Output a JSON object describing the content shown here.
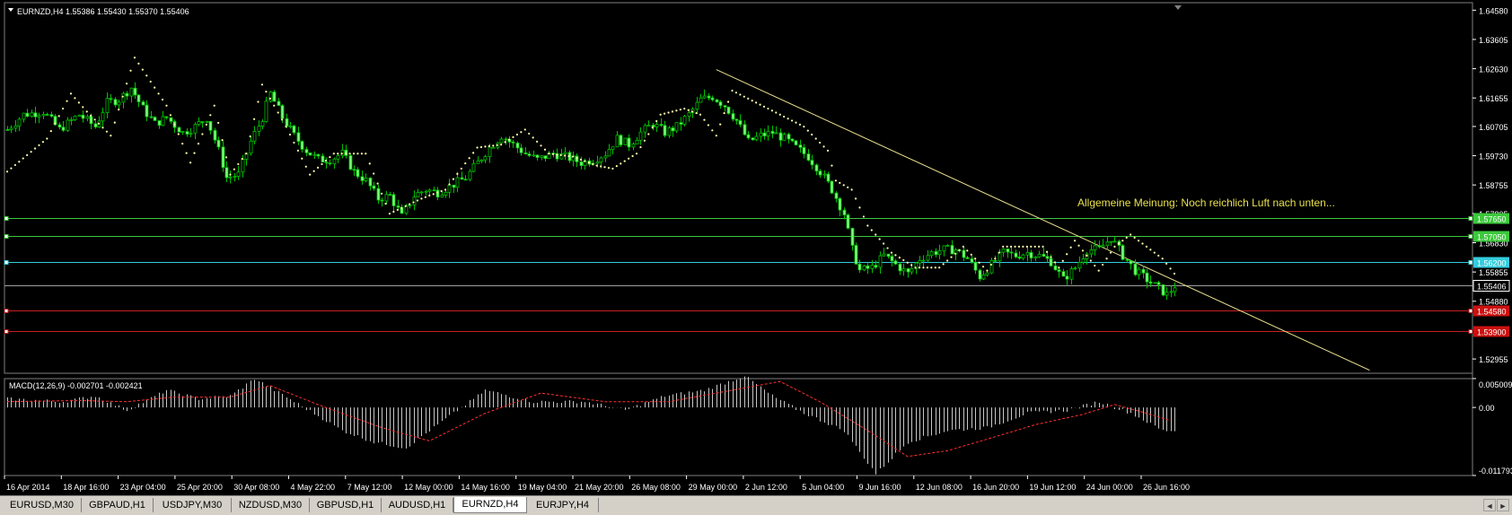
{
  "window": {
    "menu_icon": "triangle-down-icon",
    "header_text": "EURNZD,H4  1.55386 1.55430 1.55370 1.55406",
    "annotation": "Allgemeine Meinung: Noch reichlich Luft nach unten..."
  },
  "colors": {
    "background": "#000000",
    "candle": "#00c000",
    "candle_bright": "#7fff7f",
    "psar": "#ffffaa",
    "trendline": "#e8e08c",
    "annotation": "#e8e04c",
    "grid_text": "#ffffff",
    "level_green": "#3cc83c",
    "level_cyan": "#33ccdd",
    "level_red": "#c82020",
    "level_gray": "#a0a0a0",
    "macd_hist": "#c8c8c8",
    "macd_signal": "#ff3030"
  },
  "price_axis": {
    "ticks": [
      "1.64580",
      "1.63605",
      "1.62630",
      "1.61655",
      "1.60705",
      "1.59730",
      "1.58755",
      "1.57805",
      "1.56830",
      "1.55855",
      "1.54880",
      "1.52955"
    ]
  },
  "levels": [
    {
      "label": "1.57650",
      "value": 1.5765,
      "style": "green"
    },
    {
      "label": "1.57050",
      "value": 1.5705,
      "style": "green"
    },
    {
      "label": "1.56200",
      "value": 1.562,
      "style": "cyan"
    },
    {
      "label": "1.55406",
      "value": 1.55406,
      "style": "current"
    },
    {
      "label": "1.54580",
      "value": 1.5458,
      "style": "red"
    },
    {
      "label": "1.53900",
      "value": 1.539,
      "style": "red"
    }
  ],
  "macd": {
    "header": "MACD(12,26,9) -0.002701 -0.002421",
    "ticks": [
      "0.005009",
      "0.00",
      "-0.011793"
    ]
  },
  "time_axis": {
    "ticks": [
      "16 Apr 2014",
      "18 Apr 16:00",
      "23 Apr 04:00",
      "25 Apr 20:00",
      "30 Apr 08:00",
      "4 May 22:00",
      "7 May 12:00",
      "12 May 00:00",
      "14 May 16:00",
      "19 May 04:00",
      "21 May 20:00",
      "26 May 08:00",
      "29 May 00:00",
      "2 Jun 12:00",
      "5 Jun 04:00",
      "9 Jun 16:00",
      "12 Jun 08:00",
      "16 Jun 20:00",
      "19 Jun 12:00",
      "24 Jun 00:00",
      "26 Jun 16:00"
    ]
  },
  "tabs": [
    {
      "label": "EURUSD,M30",
      "active": false
    },
    {
      "label": "GBPAUD,H1",
      "active": false
    },
    {
      "label": "USDJPY,M30",
      "active": false
    },
    {
      "label": "NZDUSD,M30",
      "active": false
    },
    {
      "label": "GBPUSD,H1",
      "active": false
    },
    {
      "label": "AUDUSD,H1",
      "active": false
    },
    {
      "label": "EURNZD,H4",
      "active": true
    },
    {
      "label": "EURJPY,H4",
      "active": false
    }
  ],
  "tab_nav": {
    "left": "◄",
    "right": "►"
  },
  "chart_data": {
    "type": "candlestick",
    "symbol": "EURNZD",
    "timeframe": "H4",
    "ohlc_current": {
      "open": 1.55386,
      "high": 1.5543,
      "low": 1.5537,
      "close": 1.55406
    },
    "ylim": [
      1.5248,
      1.6483
    ],
    "close_path": [
      [
        0,
        1.606
      ],
      [
        4,
        1.611
      ],
      [
        9,
        1.612
      ],
      [
        13,
        1.606
      ],
      [
        18,
        1.611
      ],
      [
        22,
        1.607
      ],
      [
        25,
        1.615
      ],
      [
        28,
        1.616
      ],
      [
        31,
        1.62
      ],
      [
        34,
        1.613
      ],
      [
        37,
        1.608
      ],
      [
        40,
        1.61
      ],
      [
        44,
        1.605
      ],
      [
        47,
        1.607
      ],
      [
        50,
        1.61
      ],
      [
        53,
        1.599
      ],
      [
        55,
        1.59
      ],
      [
        58,
        1.591
      ],
      [
        61,
        1.602
      ],
      [
        64,
        1.61
      ],
      [
        66,
        1.618
      ],
      [
        69,
        1.61
      ],
      [
        72,
        1.604
      ],
      [
        75,
        1.599
      ],
      [
        78,
        1.596
      ],
      [
        81,
        1.596
      ],
      [
        84,
        1.598
      ],
      [
        87,
        1.592
      ],
      [
        90,
        1.589
      ],
      [
        93,
        1.583
      ],
      [
        96,
        1.584
      ],
      [
        99,
        1.577
      ],
      [
        102,
        1.584
      ],
      [
        105,
        1.586
      ],
      [
        108,
        1.585
      ],
      [
        111,
        1.587
      ],
      [
        115,
        1.59
      ],
      [
        118,
        1.595
      ],
      [
        121,
        1.6
      ],
      [
        124,
        1.604
      ],
      [
        127,
        1.601
      ],
      [
        130,
        1.598
      ],
      [
        133,
        1.596
      ],
      [
        137,
        1.598
      ],
      [
        140,
        1.597
      ],
      [
        144,
        1.595
      ],
      [
        147,
        1.596
      ],
      [
        150,
        1.598
      ],
      [
        153,
        1.603
      ],
      [
        156,
        1.601
      ],
      [
        159,
        1.605
      ],
      [
        162,
        1.608
      ],
      [
        165,
        1.605
      ],
      [
        168,
        1.607
      ],
      [
        171,
        1.611
      ],
      [
        174,
        1.616
      ],
      [
        177,
        1.617
      ],
      [
        180,
        1.614
      ],
      [
        183,
        1.609
      ],
      [
        186,
        1.602
      ],
      [
        189,
        1.604
      ],
      [
        192,
        1.605
      ],
      [
        195,
        1.603
      ],
      [
        198,
        1.6
      ],
      [
        201,
        1.597
      ],
      [
        204,
        1.592
      ],
      [
        207,
        1.586
      ],
      [
        210,
        1.578
      ],
      [
        212,
        1.566
      ],
      [
        214,
        1.559
      ],
      [
        217,
        1.56
      ],
      [
        220,
        1.564
      ],
      [
        223,
        1.561
      ],
      [
        226,
        1.558
      ],
      [
        229,
        1.563
      ],
      [
        232,
        1.565
      ],
      [
        235,
        1.566
      ],
      [
        238,
        1.566
      ],
      [
        241,
        1.563
      ],
      [
        244,
        1.557
      ],
      [
        247,
        1.561
      ],
      [
        250,
        1.565
      ],
      [
        253,
        1.564
      ],
      [
        256,
        1.565
      ],
      [
        259,
        1.564
      ],
      [
        262,
        1.562
      ],
      [
        265,
        1.556
      ],
      [
        268,
        1.56
      ],
      [
        271,
        1.566
      ],
      [
        274,
        1.566
      ],
      [
        277,
        1.57
      ],
      [
        280,
        1.564
      ],
      [
        283,
        1.559
      ],
      [
        286,
        1.556
      ],
      [
        289,
        1.553
      ],
      [
        291,
        1.551
      ],
      [
        293,
        1.554
      ]
    ],
    "psar_path": [
      [
        0,
        1.592
      ],
      [
        10,
        1.603
      ],
      [
        16,
        1.618
      ],
      [
        20,
        1.612
      ],
      [
        26,
        1.604
      ],
      [
        32,
        1.63
      ],
      [
        40,
        1.614
      ],
      [
        46,
        1.595
      ],
      [
        52,
        1.614
      ],
      [
        56,
        1.591
      ],
      [
        60,
        1.598
      ],
      [
        64,
        1.621
      ],
      [
        70,
        1.607
      ],
      [
        76,
        1.591
      ],
      [
        82,
        1.598
      ],
      [
        90,
        1.598
      ],
      [
        96,
        1.578
      ],
      [
        104,
        1.583
      ],
      [
        110,
        1.586
      ],
      [
        118,
        1.6
      ],
      [
        124,
        1.601
      ],
      [
        130,
        1.606
      ],
      [
        136,
        1.598
      ],
      [
        142,
        1.597
      ],
      [
        148,
        1.594
      ],
      [
        152,
        1.593
      ],
      [
        158,
        1.598
      ],
      [
        164,
        1.611
      ],
      [
        170,
        1.613
      ],
      [
        174,
        1.611
      ],
      [
        178,
        1.604
      ],
      [
        182,
        1.619
      ],
      [
        188,
        1.615
      ],
      [
        194,
        1.611
      ],
      [
        200,
        1.607
      ],
      [
        206,
        1.599
      ],
      [
        208,
        1.589
      ],
      [
        212,
        1.586
      ],
      [
        216,
        1.574
      ],
      [
        222,
        1.565
      ],
      [
        228,
        1.56
      ],
      [
        234,
        1.56
      ],
      [
        240,
        1.567
      ],
      [
        246,
        1.559
      ],
      [
        250,
        1.567
      ],
      [
        256,
        1.567
      ],
      [
        260,
        1.567
      ],
      [
        264,
        1.56
      ],
      [
        268,
        1.569
      ],
      [
        274,
        1.559
      ],
      [
        278,
        1.567
      ],
      [
        282,
        1.571
      ],
      [
        286,
        1.567
      ],
      [
        290,
        1.563
      ],
      [
        293,
        1.558
      ]
    ],
    "trendline": {
      "from": [
        178,
        1.626
      ],
      "to": [
        342,
        1.5258
      ]
    },
    "macd_hist_path": [
      [
        0,
        0.0015
      ],
      [
        14,
        0.001
      ],
      [
        22,
        0.002
      ],
      [
        30,
        -0.0005
      ],
      [
        40,
        0.003
      ],
      [
        48,
        0.0015
      ],
      [
        56,
        0.002
      ],
      [
        62,
        0.005
      ],
      [
        72,
        0.001
      ],
      [
        84,
        -0.004
      ],
      [
        92,
        -0.006
      ],
      [
        100,
        -0.007
      ],
      [
        110,
        -0.002
      ],
      [
        120,
        0.003
      ],
      [
        132,
        0.001
      ],
      [
        145,
        0.001
      ],
      [
        155,
        -0.0005
      ],
      [
        165,
        0.002
      ],
      [
        175,
        0.003
      ],
      [
        185,
        0.0055
      ],
      [
        192,
        0.002
      ],
      [
        200,
        -0.001
      ],
      [
        210,
        -0.004
      ],
      [
        218,
        -0.0115
      ],
      [
        226,
        -0.006
      ],
      [
        236,
        -0.004
      ],
      [
        246,
        -0.0035
      ],
      [
        256,
        -0.001
      ],
      [
        266,
        -0.0005
      ],
      [
        274,
        0.001
      ],
      [
        282,
        -0.001
      ],
      [
        290,
        -0.004
      ],
      [
        293,
        -0.004
      ]
    ],
    "macd_signal_path": [
      [
        0,
        0.001
      ],
      [
        18,
        0.0012
      ],
      [
        30,
        0.001
      ],
      [
        42,
        0.0018
      ],
      [
        56,
        0.0018
      ],
      [
        66,
        0.0038
      ],
      [
        78,
        0.0005
      ],
      [
        94,
        -0.0035
      ],
      [
        106,
        -0.0058
      ],
      [
        120,
        -0.001
      ],
      [
        134,
        0.0025
      ],
      [
        150,
        0.001
      ],
      [
        166,
        0.001
      ],
      [
        182,
        0.003
      ],
      [
        194,
        0.0045
      ],
      [
        204,
        0.001
      ],
      [
        216,
        -0.004
      ],
      [
        226,
        -0.0085
      ],
      [
        236,
        -0.0075
      ],
      [
        246,
        -0.0055
      ],
      [
        258,
        -0.003
      ],
      [
        270,
        -0.0012
      ],
      [
        278,
        0.0005
      ],
      [
        286,
        -0.001
      ],
      [
        293,
        -0.0025
      ]
    ],
    "macd_ylim": [
      -0.0118,
      0.005
    ]
  }
}
